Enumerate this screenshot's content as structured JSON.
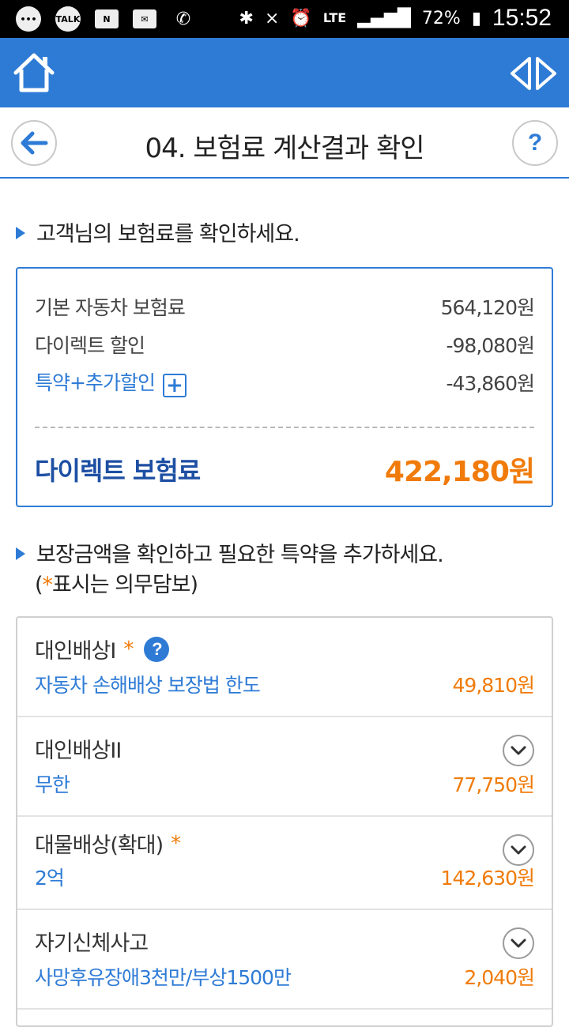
{
  "status_bar": {
    "time": "15:52",
    "battery": "72%",
    "network": "LTE",
    "notification_icons": [
      "chat-icon",
      "talk-icon",
      "news-icon",
      "mail-icon",
      "voicemail-icon"
    ],
    "talk_label": "TALK",
    "news_label": "N"
  },
  "header": {
    "title": "04. 보험료 계산결과 확인"
  },
  "section1": {
    "heading": "고객님의 보험료를 확인하세요."
  },
  "summary": {
    "rows": [
      {
        "label": "기본 자동차 보험료",
        "value": "564,120원"
      },
      {
        "label": "다이렉트 할인",
        "value": "-98,080원"
      },
      {
        "label": "특약+추가할인",
        "value": "-43,860원"
      }
    ],
    "total_label": "다이렉트 보험료",
    "total_value": "422,180원"
  },
  "section2": {
    "heading": "보장금액을 확인하고 필요한 특약을 추가하세요.",
    "note_prefix": "(",
    "note_star": "*",
    "note_text": "표시는 의무담보)"
  },
  "coverage": {
    "items": [
      {
        "name": "대인배상I",
        "desc": "자동차 손해배상 보장법 한도",
        "price": "49,810원",
        "required": "*"
      },
      {
        "name": "대인배상II",
        "desc": "무한",
        "price": "77,750원"
      },
      {
        "name": "대물배상(확대)",
        "desc": "2억",
        "price": "142,630원",
        "required": "*"
      },
      {
        "name": "자기신체사고",
        "desc": "사망후유장애3천만/부상1500만",
        "price": "2,040원"
      }
    ]
  },
  "colors": {
    "primary": "#2e7bd6",
    "accent": "#f07b0a",
    "total_label": "#1d4fa3"
  }
}
